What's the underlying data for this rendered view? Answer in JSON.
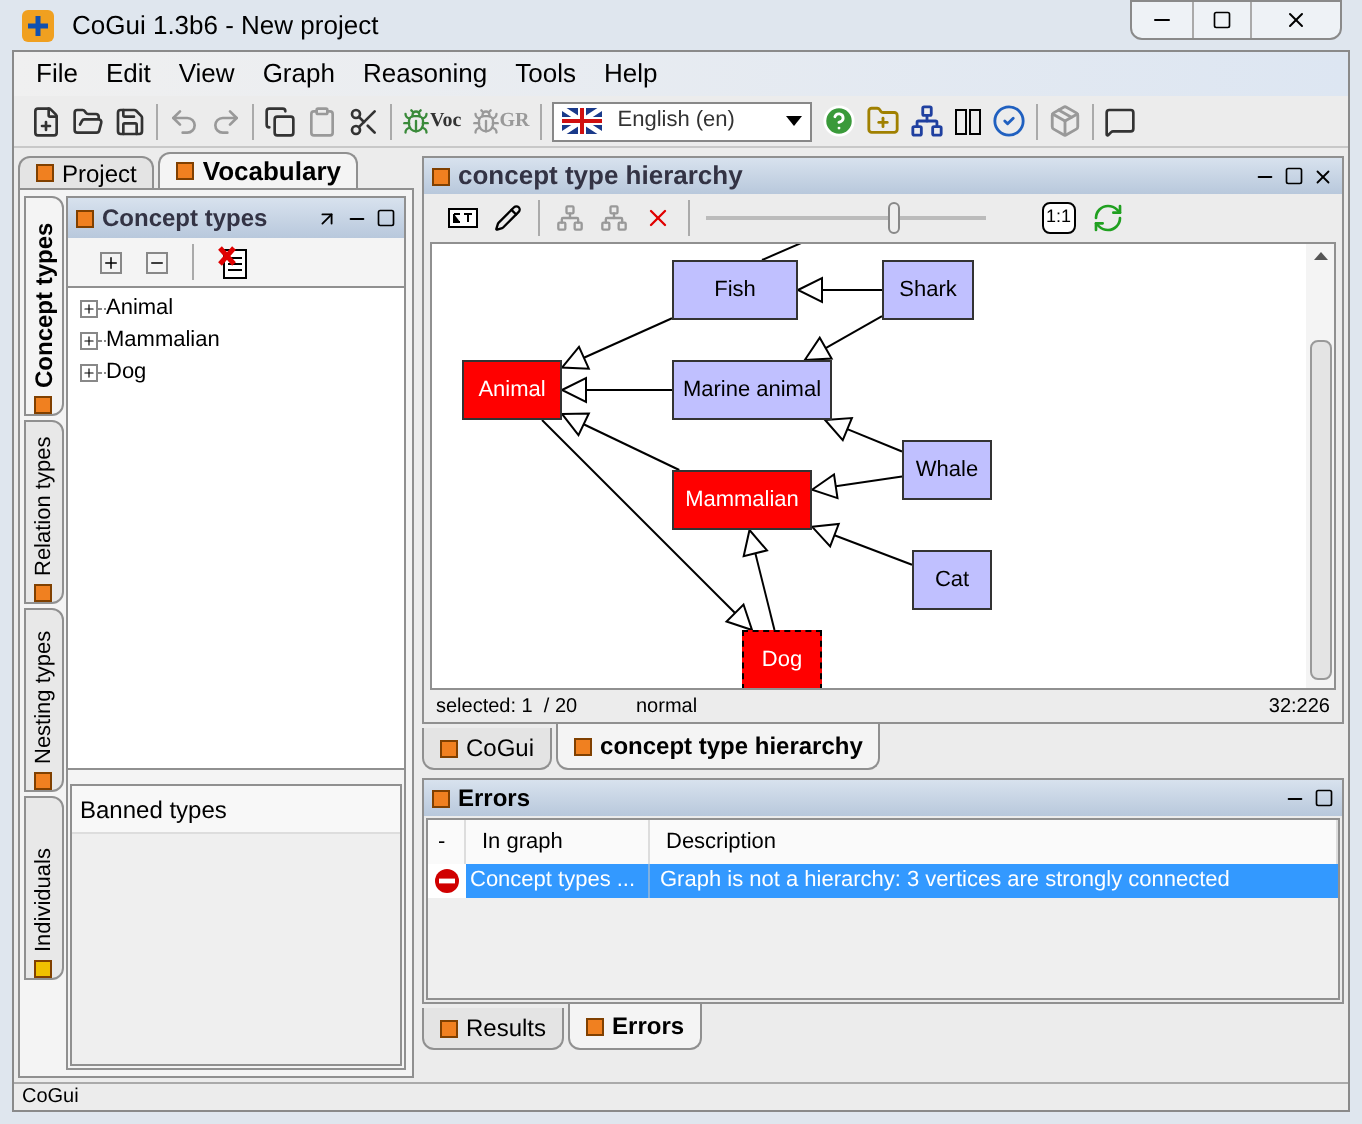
{
  "window": {
    "title": "CoGui 1.3b6 - New project"
  },
  "menu": [
    "File",
    "Edit",
    "View",
    "Graph",
    "Reasoning",
    "Tools",
    "Help"
  ],
  "toolbar": {
    "voc_label": "Voc",
    "gr_label": "GR",
    "language": "English (en)"
  },
  "left_tabs": [
    {
      "label": "Project",
      "selected": false
    },
    {
      "label": "Vocabulary",
      "selected": true
    }
  ],
  "side_tabs": [
    {
      "label": "Concept types",
      "selected": true
    },
    {
      "label": "Relation types",
      "selected": false
    },
    {
      "label": "Nesting types",
      "selected": false
    },
    {
      "label": "Individuals",
      "selected": false
    }
  ],
  "concept_panel": {
    "title": "Concept types",
    "tree": [
      {
        "label": "Animal",
        "expanded": false
      },
      {
        "label": "Mammalian",
        "expanded": false
      },
      {
        "label": "Dog",
        "expanded": false
      }
    ],
    "banned_title": "Banned types"
  },
  "editor": {
    "title": "concept type hierarchy",
    "zoom_label": "1:1",
    "zoom": {
      "level": 0.67
    },
    "nodes": [
      {
        "label": "Fish",
        "color": "#c0c0ff",
        "selected": false
      },
      {
        "label": "Shark",
        "color": "#c0c0ff",
        "selected": false
      },
      {
        "label": "Animal",
        "color": "#ff0000",
        "selected": false
      },
      {
        "label": "Marine animal",
        "color": "#c0c0ff",
        "selected": false
      },
      {
        "label": "Whale",
        "color": "#c0c0ff",
        "selected": false
      },
      {
        "label": "Mammalian",
        "color": "#ff0000",
        "selected": false
      },
      {
        "label": "Cat",
        "color": "#c0c0ff",
        "selected": false
      },
      {
        "label": "Dog",
        "color": "#ff0000",
        "selected": true
      }
    ],
    "status": {
      "selected": "selected: 1  / 20",
      "mode": "normal",
      "position": "32:226"
    }
  },
  "editor_tabs": [
    {
      "label": "CoGui",
      "selected": false
    },
    {
      "label": "concept type hierarchy",
      "selected": true
    }
  ],
  "errors": {
    "title": "Errors",
    "columns": [
      "-",
      "In graph",
      "Description"
    ],
    "rows": [
      {
        "graph": "Concept types ...",
        "description": "Graph is not a hierarchy: 3 vertices are strongly connected",
        "selected": true
      }
    ]
  },
  "bottom_tabs": [
    {
      "label": "Results",
      "selected": false
    },
    {
      "label": "Errors",
      "selected": true
    }
  ],
  "status_bar": "CoGui"
}
